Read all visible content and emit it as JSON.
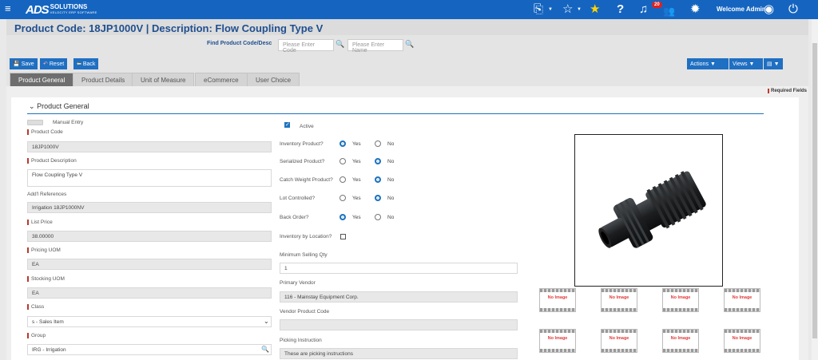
{
  "brand": {
    "logo_main": "ADS",
    "logo_word": "SOLUTIONS",
    "logo_tag": "VELOCITY ERP SOFTWARE"
  },
  "topnav": {
    "notification_count": "20",
    "welcome": "Welcome Admin"
  },
  "page": {
    "title": "Product Code:  18JP1000V | Description: Flow Coupling Type V"
  },
  "find": {
    "label": "Find Product Code/Desc",
    "code_placeholder": "Please Enter Code",
    "name_placeholder": "Please Enter Name"
  },
  "toolbar": {
    "save": "Save",
    "reset": "Reset",
    "back": "Back",
    "actions": "Actions",
    "views": "Views"
  },
  "tabs": [
    "Product General",
    "Product Details",
    "Unit of Measure",
    "eCommerce",
    "User Choice"
  ],
  "required_fields": "Required Fields",
  "section": {
    "title": "Product General"
  },
  "left": {
    "manual_entry": "Manual Entry",
    "product_code_label": "Product Code",
    "product_code": "18JP1000V",
    "product_description_label": "Product Description",
    "product_description": "Flow Coupling Type V",
    "addl_refs_label": "Add'l References",
    "addl_refs": "Irrigation 18JP1000NV",
    "list_price_label": "List Price",
    "list_price": "38.00000",
    "pricing_uom_label": "Pricing UOM",
    "pricing_uom": "EA",
    "stocking_uom_label": "Stocking UOM",
    "stocking_uom": "EA",
    "class_label": "Class",
    "class": "s - Sales Item",
    "group_label": "Group",
    "group": "IRG - Irrigation"
  },
  "middle": {
    "active": "Active",
    "inventory_product": "Inventory Product?",
    "serialized_product": "Serialized Product?",
    "catch_weight_product": "Catch Weight Product?",
    "lot_controlled": "Lot Controlled?",
    "back_order": "Back Order?",
    "yes": "Yes",
    "no": "No",
    "inventory_by_location": "Inventory by Location?",
    "min_selling_qty_label": "Minimum Selling Qty",
    "min_selling_qty": "1",
    "primary_vendor_label": "Primary Vendor",
    "primary_vendor": "116 - Mainstay Equipment Corp.",
    "vendor_product_code_label": "Vendor Product Code",
    "vendor_product_code": "",
    "picking_instruction_label": "Picking Instruction",
    "picking_instruction": "These are picking instructions"
  },
  "radios": {
    "inventory_product": "Yes",
    "serialized_product": "No",
    "catch_weight_product": "No",
    "lot_controlled": "No",
    "back_order": "Yes"
  },
  "no_image": "No Image",
  "colors": {
    "topbar": "#1565c0",
    "accent": "#1e73be",
    "title": "#1f4f8f",
    "required": "#b8392c"
  }
}
